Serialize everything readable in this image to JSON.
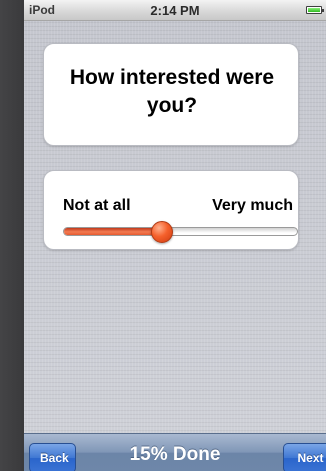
{
  "status_bar": {
    "carrier": "iPod",
    "time": "2:14 PM",
    "battery_icon": "battery-icon",
    "battery_color": "#2fb81e"
  },
  "question": {
    "text": "How interested were you?"
  },
  "slider": {
    "min_label": "Not at all",
    "max_label": "Very much",
    "value": 0.42,
    "accent_color": "#f5612c"
  },
  "toolbar": {
    "back_label": "Back",
    "progress_text": "15% Done",
    "next_label": "Next"
  }
}
